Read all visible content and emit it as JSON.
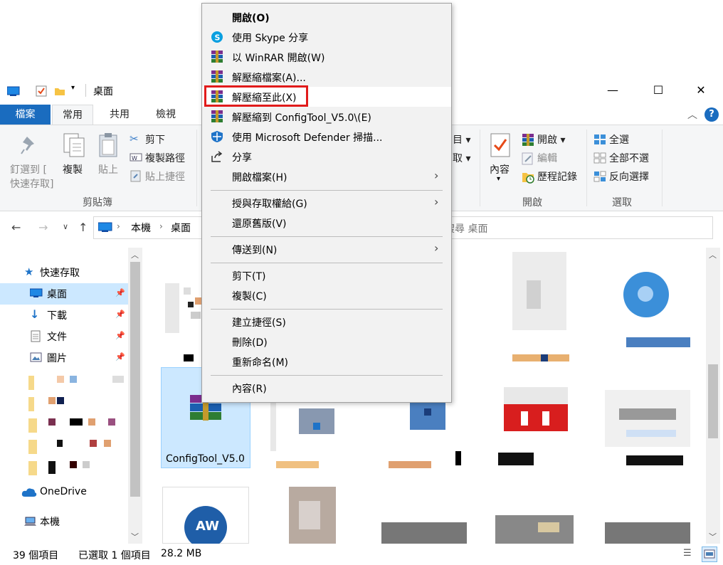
{
  "window": {
    "title": "桌面",
    "controls": {
      "minimize": "—",
      "maximize": "☐",
      "close": "✕"
    }
  },
  "ribbon_tabs": [
    "檔案",
    "常用",
    "共用",
    "檢視"
  ],
  "ribbon": {
    "pin_label_1": "釘選到 [",
    "pin_label_2": "快速存取]",
    "copy": "複製",
    "paste": "貼上",
    "cut": "剪下",
    "copy_path": "複製路徑",
    "paste_shortcut": "貼上捷徑",
    "clipboard_group": "剪貼簿",
    "move_to_partial": "目",
    "copy_to_partial": "取",
    "properties": "內容",
    "open": "開啟",
    "edit": "編輯",
    "history": "歷程記錄",
    "open_group": "開啟",
    "select_all": "全選",
    "select_none": "全部不選",
    "invert_selection": "反向選擇",
    "select_group": "選取"
  },
  "address": {
    "crumbs": [
      "本機",
      "桌面"
    ],
    "search_placeholder": "搜尋 桌面"
  },
  "nav": {
    "quick_access": "快速存取",
    "items": [
      {
        "label": "桌面",
        "icon": "desktop-icon"
      },
      {
        "label": "下載",
        "icon": "download-icon"
      },
      {
        "label": "文件",
        "icon": "document-icon"
      },
      {
        "label": "圖片",
        "icon": "picture-icon"
      }
    ],
    "onedrive": "OneDrive",
    "this_pc": "本機"
  },
  "content": {
    "selected_file": "ConfigTool_V5.0"
  },
  "status": {
    "count": "39 個項目",
    "selected": "已選取 1 個項目",
    "size": "28.2 MB"
  },
  "context_menu": {
    "items": [
      {
        "label": "開啟(O)",
        "bold": true
      },
      {
        "label": "使用 Skype 分享",
        "icon": "skype-icon"
      },
      {
        "label": "以 WinRAR 開啟(W)",
        "icon": "winrar-icon"
      },
      {
        "label": "解壓縮檔案(A)...",
        "icon": "winrar-icon"
      },
      {
        "label": "解壓縮至此(X)",
        "icon": "winrar-icon",
        "highlighted": true
      },
      {
        "label": "解壓縮到 ConfigTool_V5.0\\(E)",
        "icon": "winrar-icon"
      },
      {
        "label": "使用 Microsoft Defender 掃描...",
        "icon": "defender-shield-icon"
      },
      {
        "label": "分享",
        "icon": "share-icon"
      },
      {
        "label": "開啟檔案(H)",
        "submenu": true
      },
      {
        "label": "授與存取權給(G)",
        "submenu": true
      },
      {
        "label": "還原舊版(V)"
      },
      {
        "label": "傳送到(N)",
        "submenu": true
      },
      {
        "label": "剪下(T)"
      },
      {
        "label": "複製(C)"
      },
      {
        "label": "建立捷徑(S)"
      },
      {
        "label": "刪除(D)"
      },
      {
        "label": "重新命名(M)"
      },
      {
        "label": "內容(R)"
      }
    ]
  },
  "colors": {
    "accent": "#1a6cbf",
    "selection": "#cce8ff",
    "highlight_border": "#e11b1b"
  }
}
